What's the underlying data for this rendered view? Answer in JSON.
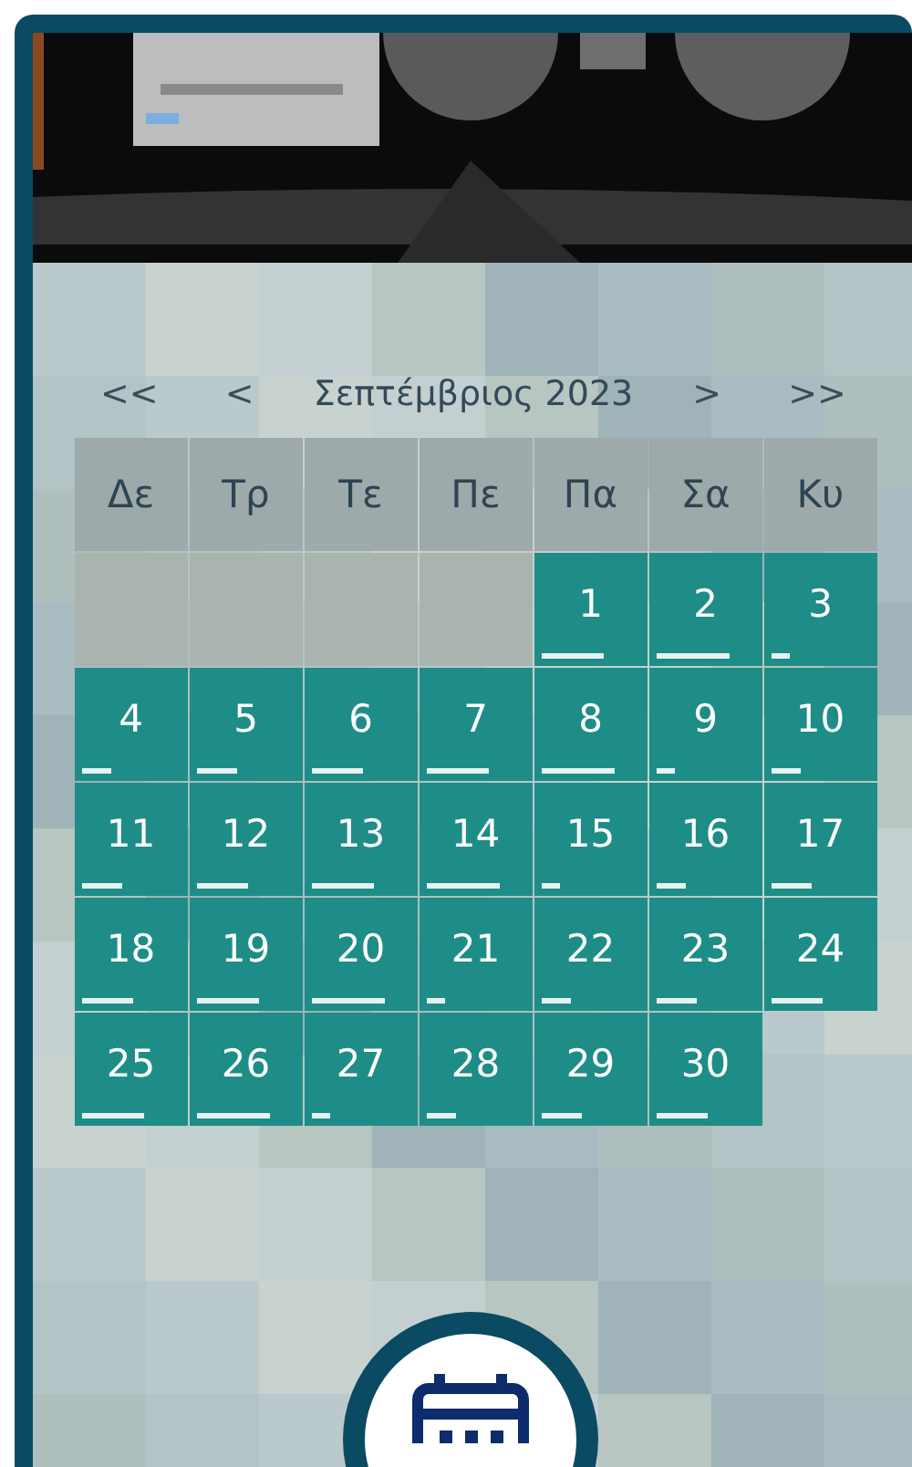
{
  "calendar": {
    "nav": {
      "prev_year": "<<",
      "prev_month": "<",
      "title": "Σεπτέμβριος 2023",
      "next_month": ">",
      "next_year": ">>"
    },
    "weekdays": [
      "Δε",
      "Τρ",
      "Τε",
      "Πε",
      "Πα",
      "Σα",
      "Κυ"
    ],
    "cells": [
      {
        "kind": "blank"
      },
      {
        "kind": "blank"
      },
      {
        "kind": "blank"
      },
      {
        "kind": "blank"
      },
      {
        "kind": "day",
        "label": "1"
      },
      {
        "kind": "day",
        "label": "2"
      },
      {
        "kind": "day",
        "label": "3"
      },
      {
        "kind": "day",
        "label": "4"
      },
      {
        "kind": "day",
        "label": "5"
      },
      {
        "kind": "day",
        "label": "6"
      },
      {
        "kind": "day",
        "label": "7"
      },
      {
        "kind": "day",
        "label": "8"
      },
      {
        "kind": "day",
        "label": "9"
      },
      {
        "kind": "day",
        "label": "10"
      },
      {
        "kind": "day",
        "label": "11"
      },
      {
        "kind": "day",
        "label": "12"
      },
      {
        "kind": "day",
        "label": "13"
      },
      {
        "kind": "day",
        "label": "14"
      },
      {
        "kind": "day",
        "label": "15"
      },
      {
        "kind": "day",
        "label": "16"
      },
      {
        "kind": "day",
        "label": "17"
      },
      {
        "kind": "day",
        "label": "18"
      },
      {
        "kind": "day",
        "label": "19"
      },
      {
        "kind": "day",
        "label": "20"
      },
      {
        "kind": "day",
        "label": "21"
      },
      {
        "kind": "day",
        "label": "22"
      },
      {
        "kind": "day",
        "label": "23"
      },
      {
        "kind": "day",
        "label": "24"
      },
      {
        "kind": "day",
        "label": "25"
      },
      {
        "kind": "day",
        "label": "26"
      },
      {
        "kind": "day",
        "label": "27"
      },
      {
        "kind": "day",
        "label": "28"
      },
      {
        "kind": "day",
        "label": "29"
      },
      {
        "kind": "day",
        "label": "30"
      },
      {
        "kind": "blank"
      }
    ]
  }
}
